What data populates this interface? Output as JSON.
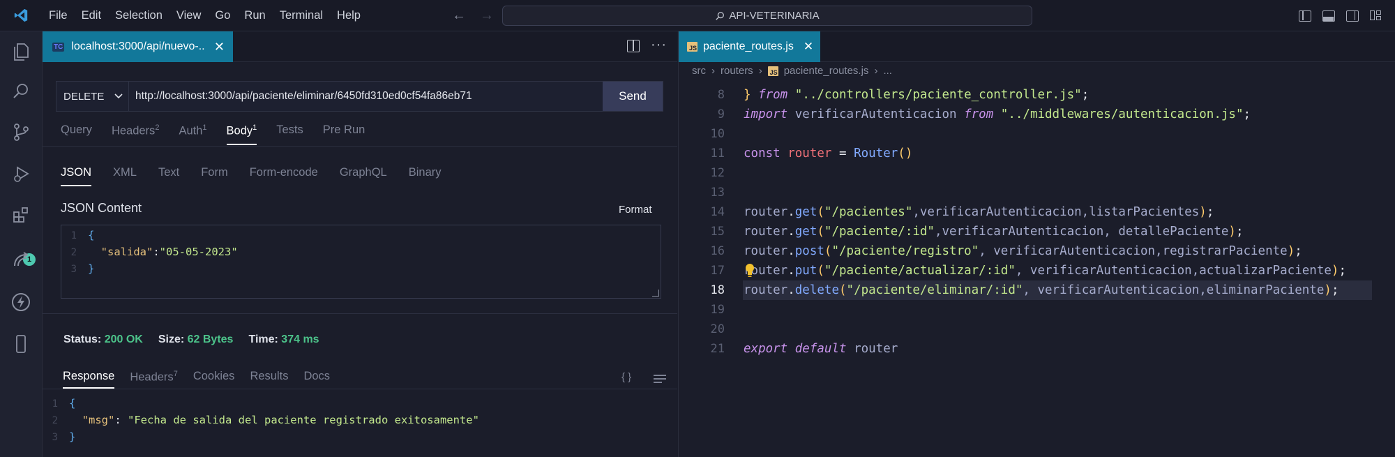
{
  "menu": [
    "File",
    "Edit",
    "Selection",
    "View",
    "Go",
    "Run",
    "Terminal",
    "Help"
  ],
  "search": {
    "text": "API-VETERINARIA"
  },
  "activity_bar": {
    "extensions_badge": "1"
  },
  "left_panel": {
    "tab": {
      "badge": "TC",
      "label": "localhost:3000/api/nuevo-..",
      "close": "✕"
    },
    "request": {
      "method": "DELETE",
      "url": "http://localhost:3000/api/paciente/eliminar/6450fd310ed0cf54fa86eb71",
      "send_label": "Send"
    },
    "request_tabs": [
      {
        "label": "Query",
        "count": ""
      },
      {
        "label": "Headers",
        "count": "2"
      },
      {
        "label": "Auth",
        "count": "1"
      },
      {
        "label": "Body",
        "count": "1"
      },
      {
        "label": "Tests",
        "count": ""
      },
      {
        "label": "Pre Run",
        "count": ""
      }
    ],
    "body_tabs": [
      "JSON",
      "XML",
      "Text",
      "Form",
      "Form-encode",
      "GraphQL",
      "Binary"
    ],
    "json_content_label": "JSON Content",
    "format_label": "Format",
    "json_body": {
      "line_numbers": [
        "1",
        "2",
        "3"
      ],
      "open": "{",
      "key": "\"salida\"",
      "colon": ":",
      "value": "\"05-05-2023\"",
      "close": "}"
    },
    "status": {
      "status_label": "Status:",
      "status_value": "200 OK",
      "size_label": "Size:",
      "size_value": "62 Bytes",
      "time_label": "Time:",
      "time_value": "374 ms"
    },
    "response_tabs": [
      {
        "label": "Response",
        "count": ""
      },
      {
        "label": "Headers",
        "count": "7"
      },
      {
        "label": "Cookies",
        "count": ""
      },
      {
        "label": "Results",
        "count": ""
      },
      {
        "label": "Docs",
        "count": ""
      }
    ],
    "braces_icon": "{ }",
    "response_body": {
      "line_numbers": [
        "1",
        "2",
        "3"
      ],
      "open": "{",
      "key": "\"msg\"",
      "colon": ": ",
      "value": "\"Fecha de salida del paciente registrado exitosamente\"",
      "close": "}"
    }
  },
  "right_panel": {
    "tab": {
      "icon": "JS",
      "label": "paciente_routes.js",
      "close": "✕"
    },
    "breadcrumb": [
      "src",
      "routers",
      "paciente_routes.js",
      "..."
    ],
    "line_numbers": [
      "8",
      "9",
      "10",
      "11",
      "12",
      "13",
      "14",
      "15",
      "16",
      "17",
      "18",
      "19",
      "20",
      "21"
    ],
    "code": {
      "l8": {
        "a": "} ",
        "b": "from",
        "c": " ",
        "d": "\"../controllers/paciente_controller.js\"",
        "e": ";"
      },
      "l9": {
        "a": "import",
        "b": " verificarAutenticacion ",
        "c": "from",
        "d": " ",
        "e": "\"../middlewares/autenticacion.js\"",
        "f": ";"
      },
      "l11": {
        "a": "const",
        "b": " ",
        "c": "router",
        "d": " = ",
        "e": "Router",
        "f": "()"
      },
      "l14": {
        "a": "router",
        "b": ".",
        "c": "get",
        "d": "(",
        "e": "\"/pacientes\"",
        "f": ",verificarAutenticacion,listarPacientes",
        "g": ")",
        "h": ";"
      },
      "l15": {
        "a": "router",
        "b": ".",
        "c": "get",
        "d": "(",
        "e": "\"/paciente/:id\"",
        "f": ",verificarAutenticacion, detallePaciente",
        "g": ")",
        "h": ";"
      },
      "l16": {
        "a": "router",
        "b": ".",
        "c": "post",
        "d": "(",
        "e": "\"/paciente/registro\"",
        "f": ", verificarAutenticacion,registrarPaciente",
        "g": ")",
        "h": ";"
      },
      "l17": {
        "a": "router",
        "b": ".",
        "c": "put",
        "d": "(",
        "e": "\"/paciente/actualizar/:id\"",
        "f": ", verificarAutenticacion,actualizarPaciente",
        "g": ")",
        "h": ";"
      },
      "l18": {
        "a": "router",
        "b": ".",
        "c": "delete",
        "d": "(",
        "e": "\"/paciente/eliminar/:id\"",
        "f": ", verificarAutenticacion,eliminarPaciente",
        "g": ")",
        "h": ";"
      },
      "l21": {
        "a": "export",
        "b": " ",
        "c": "default",
        "d": " router"
      }
    },
    "current_line": "18"
  },
  "colors": {
    "accent_tab": "#12789a",
    "status_ok": "#4cc38a",
    "badge": "#4ec9b0"
  }
}
